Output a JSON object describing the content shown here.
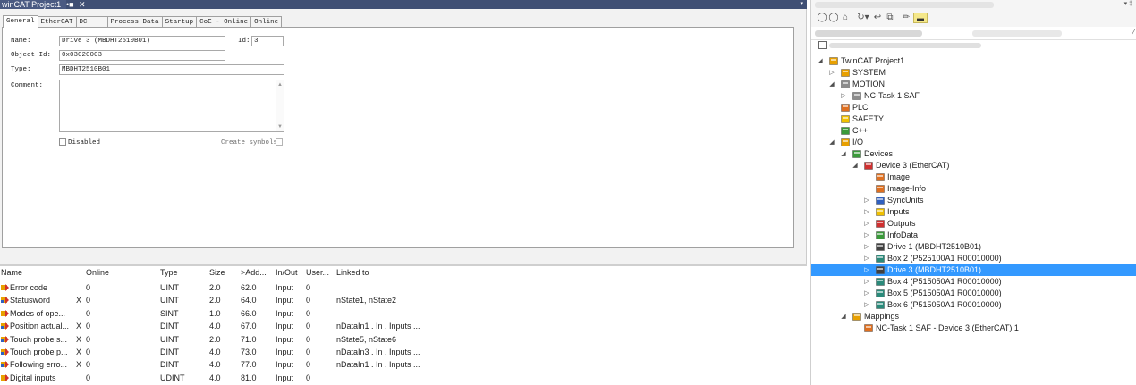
{
  "doc_tab": {
    "title": "winCAT Project1",
    "pin": "•■",
    "close": "✕",
    "dropdown": "▾"
  },
  "prop_tabs": [
    "General",
    "EtherCAT",
    "DC",
    "Process Data",
    "Startup",
    "CoE - Online",
    "Online"
  ],
  "form": {
    "name_label": "Name:",
    "name_value": "Drive 3 (MBDHT2510B01)",
    "id_label": "Id:",
    "id_value": "3",
    "objid_label": "Object Id:",
    "objid_value": "0x03020003",
    "type_label": "Type:",
    "type_value": "MBDHT2510B01",
    "comment_label": "Comment:",
    "disabled_label": "Disabled",
    "create_symbols_label": "Create symbols"
  },
  "var_columns": [
    "Name",
    "Online",
    "Type",
    "Size",
    ">Add...",
    "In/Out",
    "User...",
    "Linked to"
  ],
  "var_rows": [
    {
      "name": "Error code",
      "x": "",
      "online": "0",
      "type": "UINT",
      "size": "2.0",
      "addr": "62.0",
      "inout": "Input",
      "user": "0",
      "linked": "",
      "icon": "input-var-icon"
    },
    {
      "name": "Statusword",
      "x": "X",
      "online": "0",
      "type": "UINT",
      "size": "2.0",
      "addr": "64.0",
      "inout": "Input",
      "user": "0",
      "linked": "nState1, nState2",
      "icon": "linked-input-var-icon"
    },
    {
      "name": "Modes of ope...",
      "x": "",
      "online": "0",
      "type": "SINT",
      "size": "1.0",
      "addr": "66.0",
      "inout": "Input",
      "user": "0",
      "linked": "",
      "icon": "input-var-icon"
    },
    {
      "name": "Position actual...",
      "x": "X",
      "online": "0",
      "type": "DINT",
      "size": "4.0",
      "addr": "67.0",
      "inout": "Input",
      "user": "0",
      "linked": "nDataIn1 . In . Inputs ...",
      "icon": "linked-input-var-icon"
    },
    {
      "name": "Touch probe s...",
      "x": "X",
      "online": "0",
      "type": "UINT",
      "size": "2.0",
      "addr": "71.0",
      "inout": "Input",
      "user": "0",
      "linked": "nState5, nState6",
      "icon": "linked-input-var-icon"
    },
    {
      "name": "Touch probe p...",
      "x": "X",
      "online": "0",
      "type": "DINT",
      "size": "4.0",
      "addr": "73.0",
      "inout": "Input",
      "user": "0",
      "linked": "nDataIn3 . In . Inputs ...",
      "icon": "linked-input-var-icon"
    },
    {
      "name": "Following erro...",
      "x": "X",
      "online": "0",
      "type": "DINT",
      "size": "4.0",
      "addr": "77.0",
      "inout": "Input",
      "user": "0",
      "linked": "nDataIn1 . In . Inputs ...",
      "icon": "linked-input-var-icon"
    },
    {
      "name": "Digital inputs",
      "x": "",
      "online": "0",
      "type": "UDINT",
      "size": "4.0",
      "addr": "81.0",
      "inout": "Input",
      "user": "0",
      "linked": "",
      "icon": "input-var-icon"
    }
  ],
  "explorer": {
    "toolbar_icons": [
      "back-icon",
      "forward-icon",
      "home-icon",
      "sync-icon",
      "undo-icon",
      "collapse-icon",
      "properties-icon",
      "pin-icon"
    ],
    "tree": [
      {
        "label": "TwinCAT Project1",
        "depth": 0,
        "arrow": "◢",
        "icon": "project-icon",
        "color": "#e8a000"
      },
      {
        "label": "SYSTEM",
        "depth": 1,
        "arrow": "▷",
        "icon": "system-icon",
        "color": "#e8a000"
      },
      {
        "label": "MOTION",
        "depth": 1,
        "arrow": "◢",
        "icon": "motion-icon",
        "color": "#8c8c8c"
      },
      {
        "label": "NC-Task 1 SAF",
        "depth": 2,
        "arrow": "▷",
        "icon": "nc-task-icon",
        "color": "#8c8c8c"
      },
      {
        "label": "PLC",
        "depth": 1,
        "arrow": "",
        "icon": "plc-icon",
        "color": "#e07020"
      },
      {
        "label": "SAFETY",
        "depth": 1,
        "arrow": "",
        "icon": "safety-icon",
        "color": "#f0c000"
      },
      {
        "label": "C++",
        "depth": 1,
        "arrow": "",
        "icon": "cpp-icon",
        "color": "#3a9a3a"
      },
      {
        "label": "I/O",
        "depth": 1,
        "arrow": "◢",
        "icon": "io-icon",
        "color": "#e8a000"
      },
      {
        "label": "Devices",
        "depth": 2,
        "arrow": "◢",
        "icon": "devices-icon",
        "color": "#3a9a3a"
      },
      {
        "label": "Device 3 (EtherCAT)",
        "depth": 3,
        "arrow": "◢",
        "icon": "ethercat-device-icon",
        "color": "#d03030"
      },
      {
        "label": "Image",
        "depth": 4,
        "arrow": "",
        "icon": "image-icon",
        "color": "#e07020"
      },
      {
        "label": "Image-Info",
        "depth": 4,
        "arrow": "",
        "icon": "image-info-icon",
        "color": "#e07020"
      },
      {
        "label": "SyncUnits",
        "depth": 4,
        "arrow": "▷",
        "icon": "syncunits-icon",
        "color": "#3060c0"
      },
      {
        "label": "Inputs",
        "depth": 4,
        "arrow": "▷",
        "icon": "inputs-folder-icon",
        "color": "#f0c000"
      },
      {
        "label": "Outputs",
        "depth": 4,
        "arrow": "▷",
        "icon": "outputs-folder-icon",
        "color": "#d03030"
      },
      {
        "label": "InfoData",
        "depth": 4,
        "arrow": "▷",
        "icon": "infodata-folder-icon",
        "color": "#3a9a3a"
      },
      {
        "label": "Drive 1 (MBDHT2510B01)",
        "depth": 4,
        "arrow": "▷",
        "icon": "drive-icon",
        "color": "#404040"
      },
      {
        "label": "Box 2 (P525100A1 R00010000)",
        "depth": 4,
        "arrow": "▷",
        "icon": "box-icon",
        "color": "#2a8a7a"
      },
      {
        "label": "Drive 3 (MBDHT2510B01)",
        "depth": 4,
        "arrow": "▷",
        "icon": "drive-icon",
        "color": "#404040",
        "selected": true
      },
      {
        "label": "Box 4 (P515050A1 R00010000)",
        "depth": 4,
        "arrow": "▷",
        "icon": "box-icon",
        "color": "#2a8a7a"
      },
      {
        "label": "Box 5 (P515050A1 R00010000)",
        "depth": 4,
        "arrow": "▷",
        "icon": "box-icon",
        "color": "#2a8a7a"
      },
      {
        "label": "Box 6 (P515050A1 R00010000)",
        "depth": 4,
        "arrow": "▷",
        "icon": "box-icon",
        "color": "#2a8a7a"
      },
      {
        "label": "Mappings",
        "depth": 2,
        "arrow": "◢",
        "icon": "mappings-icon",
        "color": "#e8a000"
      },
      {
        "label": "NC-Task 1 SAF - Device 3 (EtherCAT) 1",
        "depth": 3,
        "arrow": "",
        "icon": "mapping-icon",
        "color": "#e07020"
      }
    ]
  }
}
